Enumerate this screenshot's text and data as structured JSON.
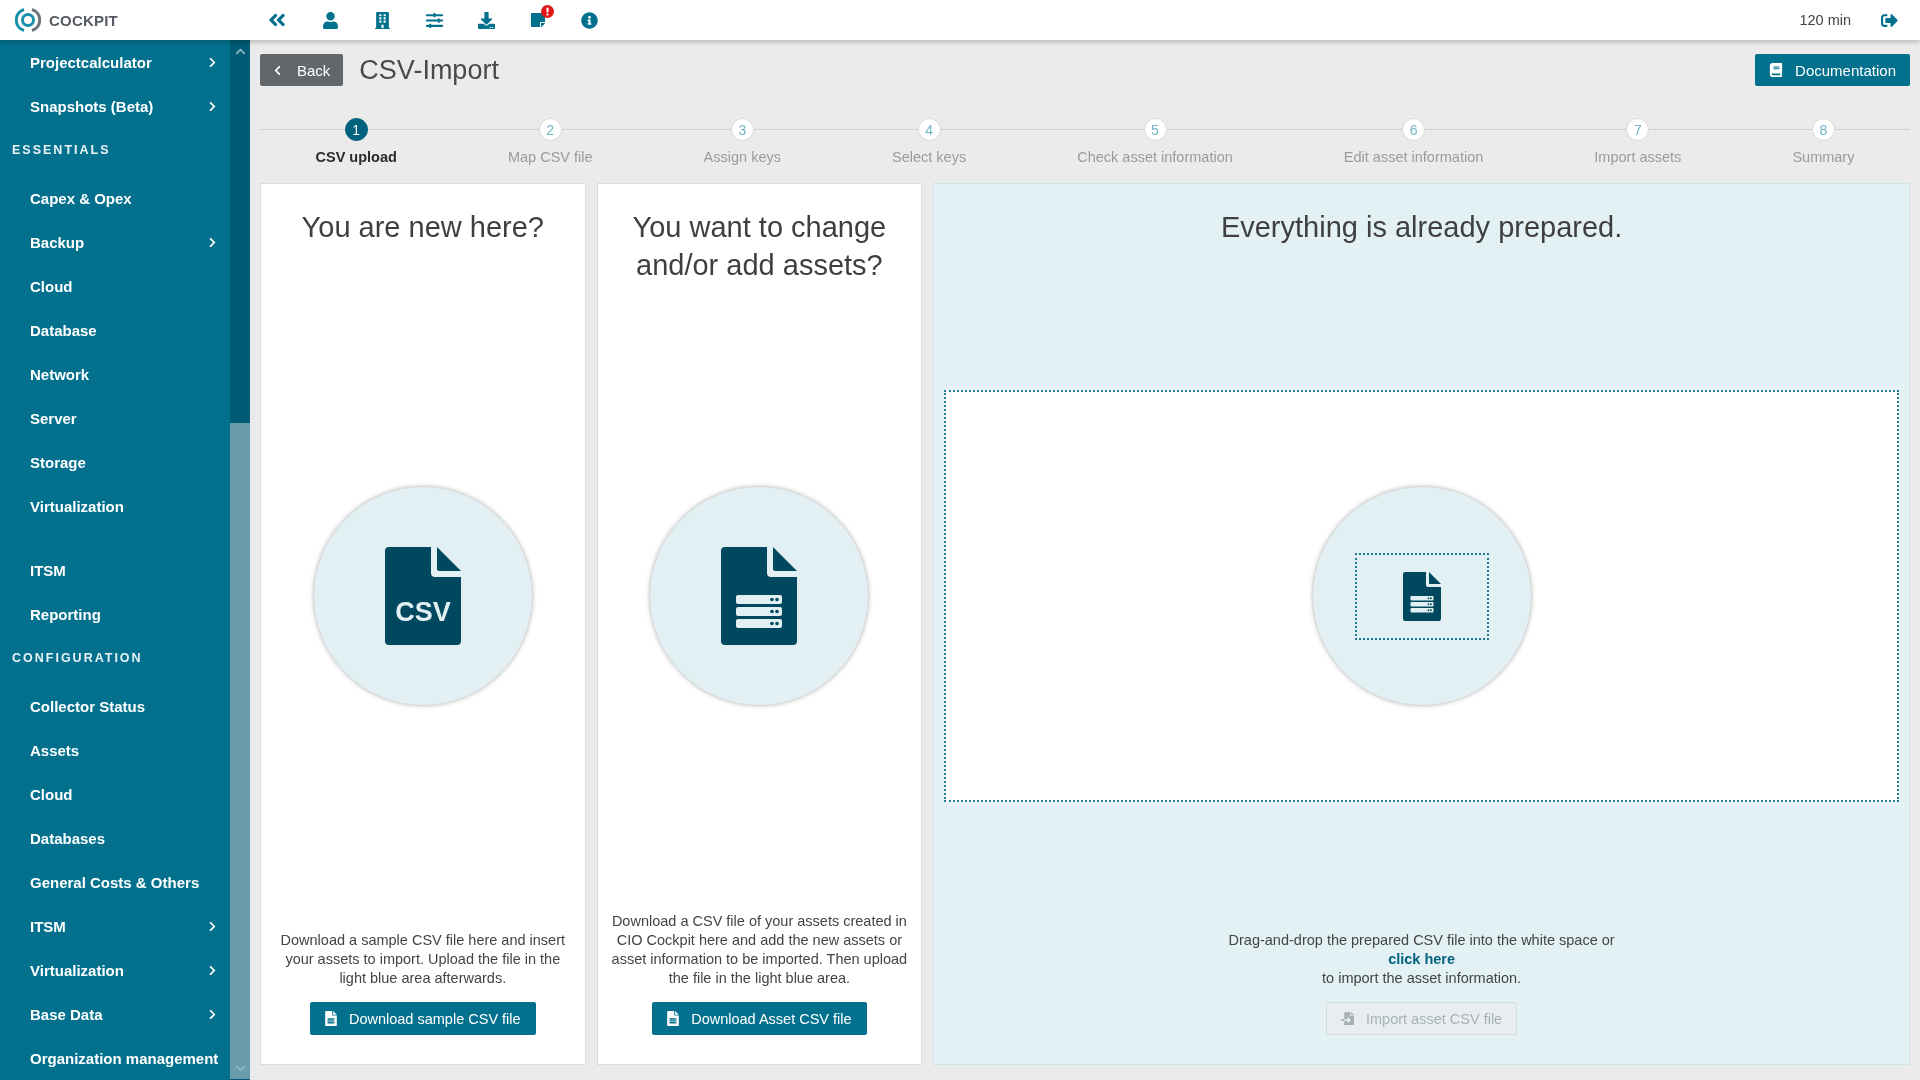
{
  "header": {
    "logo_text": "COCKPIT",
    "notification_alert": true,
    "session_time": "120 min"
  },
  "sidebar": {
    "sections": [
      {
        "items": [
          {
            "label": "Projectcalculator",
            "submenu": true
          },
          {
            "label": "Snapshots (Beta)",
            "submenu": true
          }
        ]
      },
      {
        "title": "ESSENTIALS",
        "items": [
          {
            "label": "Capex & Opex",
            "submenu": false
          },
          {
            "label": "Backup",
            "submenu": true
          },
          {
            "label": "Cloud",
            "submenu": false
          },
          {
            "label": "Database",
            "submenu": false
          },
          {
            "label": "Network",
            "submenu": false
          },
          {
            "label": "Server",
            "submenu": false
          },
          {
            "label": "Storage",
            "submenu": false
          },
          {
            "label": "Virtualization",
            "submenu": false
          }
        ]
      },
      {
        "items": [
          {
            "label": "ITSM",
            "submenu": false
          },
          {
            "label": "Reporting",
            "submenu": false
          }
        ]
      },
      {
        "title": "CONFIGURATION",
        "items": [
          {
            "label": "Collector Status",
            "submenu": false
          },
          {
            "label": "Assets",
            "submenu": false
          },
          {
            "label": "Cloud",
            "submenu": false
          },
          {
            "label": "Databases",
            "submenu": false
          },
          {
            "label": "General Costs & Others",
            "submenu": false
          },
          {
            "label": "ITSM",
            "submenu": true
          },
          {
            "label": "Virtualization",
            "submenu": true
          },
          {
            "label": "Base Data",
            "submenu": true
          },
          {
            "label": "Organization management",
            "submenu": false
          }
        ]
      }
    ]
  },
  "page": {
    "back_label": "Back",
    "title": "CSV-Import",
    "documentation_label": "Documentation"
  },
  "steps": [
    {
      "number": "1",
      "label": "CSV upload",
      "current": true
    },
    {
      "number": "2",
      "label": "Map CSV file",
      "current": false
    },
    {
      "number": "3",
      "label": "Assign keys",
      "current": false
    },
    {
      "number": "4",
      "label": "Select keys",
      "current": false
    },
    {
      "number": "5",
      "label": "Check asset information",
      "current": false
    },
    {
      "number": "6",
      "label": "Edit asset information",
      "current": false
    },
    {
      "number": "7",
      "label": "Import assets",
      "current": false
    },
    {
      "number": "8",
      "label": "Summary",
      "current": false
    }
  ],
  "cards": [
    {
      "kind": "download",
      "title": "You are new here?",
      "icon": {
        "kind": "csv",
        "text": "CSV"
      },
      "description": "Download a sample CSV file here and insert your assets to import. Upload the file in the light blue area afterwards.",
      "button": {
        "label": "Download sample CSV file",
        "disabled": false
      }
    },
    {
      "kind": "download",
      "title": "You want to change and/or add assets?",
      "icon": {
        "kind": "document"
      },
      "description": "Download a CSV file of your assets created in CIO Cockpit here and add the new assets or asset information to be imported. Then upload the file in the light blue area.",
      "button": {
        "label": "Download Asset CSV file",
        "disabled": false
      }
    },
    {
      "kind": "dropzone",
      "title": "Everything is already prepared.",
      "icon": {
        "kind": "document"
      },
      "text_before": "Drag-and-drop the prepared CSV file into the white space or",
      "link": "click here",
      "text_after": "to import the asset information.",
      "button": {
        "label": "Import asset CSV file",
        "disabled": true
      }
    }
  ]
}
